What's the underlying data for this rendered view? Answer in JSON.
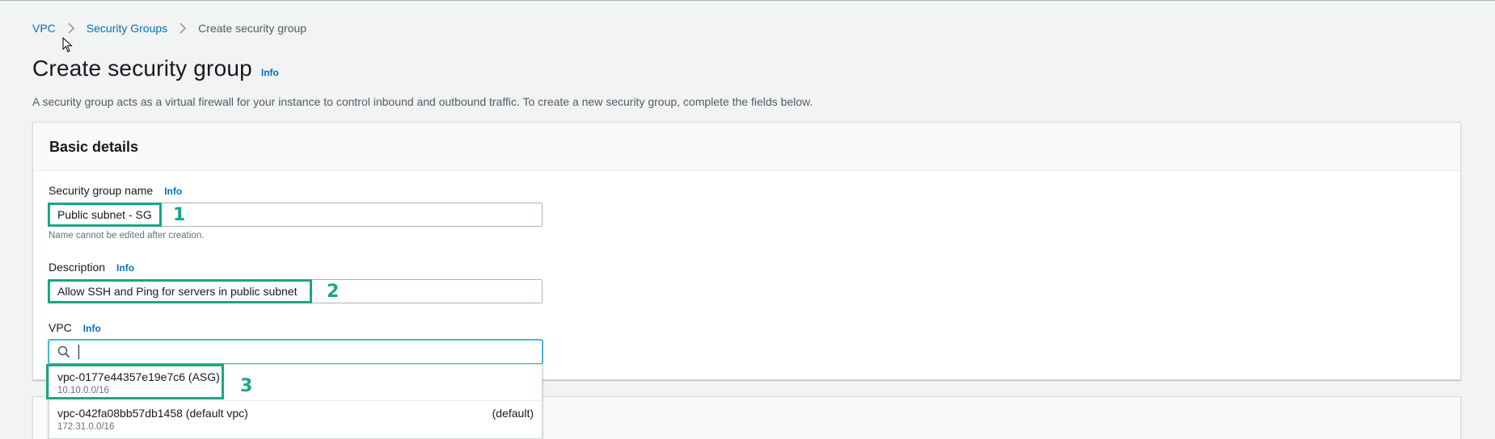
{
  "breadcrumb": {
    "items": [
      "VPC",
      "Security Groups"
    ],
    "current": "Create security group"
  },
  "page": {
    "title": "Create security group",
    "info": "Info",
    "description": "A security group acts as a virtual firewall for your instance to control inbound and outbound traffic. To create a new security group, complete the fields below."
  },
  "basic_details": {
    "heading": "Basic details",
    "name": {
      "label": "Security group name",
      "info": "Info",
      "value": "Public subnet - SG",
      "constraint": "Name cannot be edited after creation."
    },
    "description": {
      "label": "Description",
      "info": "Info",
      "value": "Allow SSH and Ping for servers in public subnet"
    },
    "vpc": {
      "label": "VPC",
      "info": "Info",
      "search_value": "",
      "options": [
        {
          "label": "vpc-0177e44357e19e7c6 (ASG)",
          "cidr": "10.10.0.0/16",
          "tag": ""
        },
        {
          "label": "vpc-042fa08bb57db1458 (default vpc)",
          "cidr": "172.31.0.0/16",
          "tag": "(default)"
        }
      ]
    }
  },
  "annotations": {
    "step1": "1",
    "step2": "2",
    "step3": "3",
    "color": "#1ba587"
  },
  "colors": {
    "link": "#0073bb",
    "focus": "#44b9d6",
    "background": "#f2f3f3"
  }
}
